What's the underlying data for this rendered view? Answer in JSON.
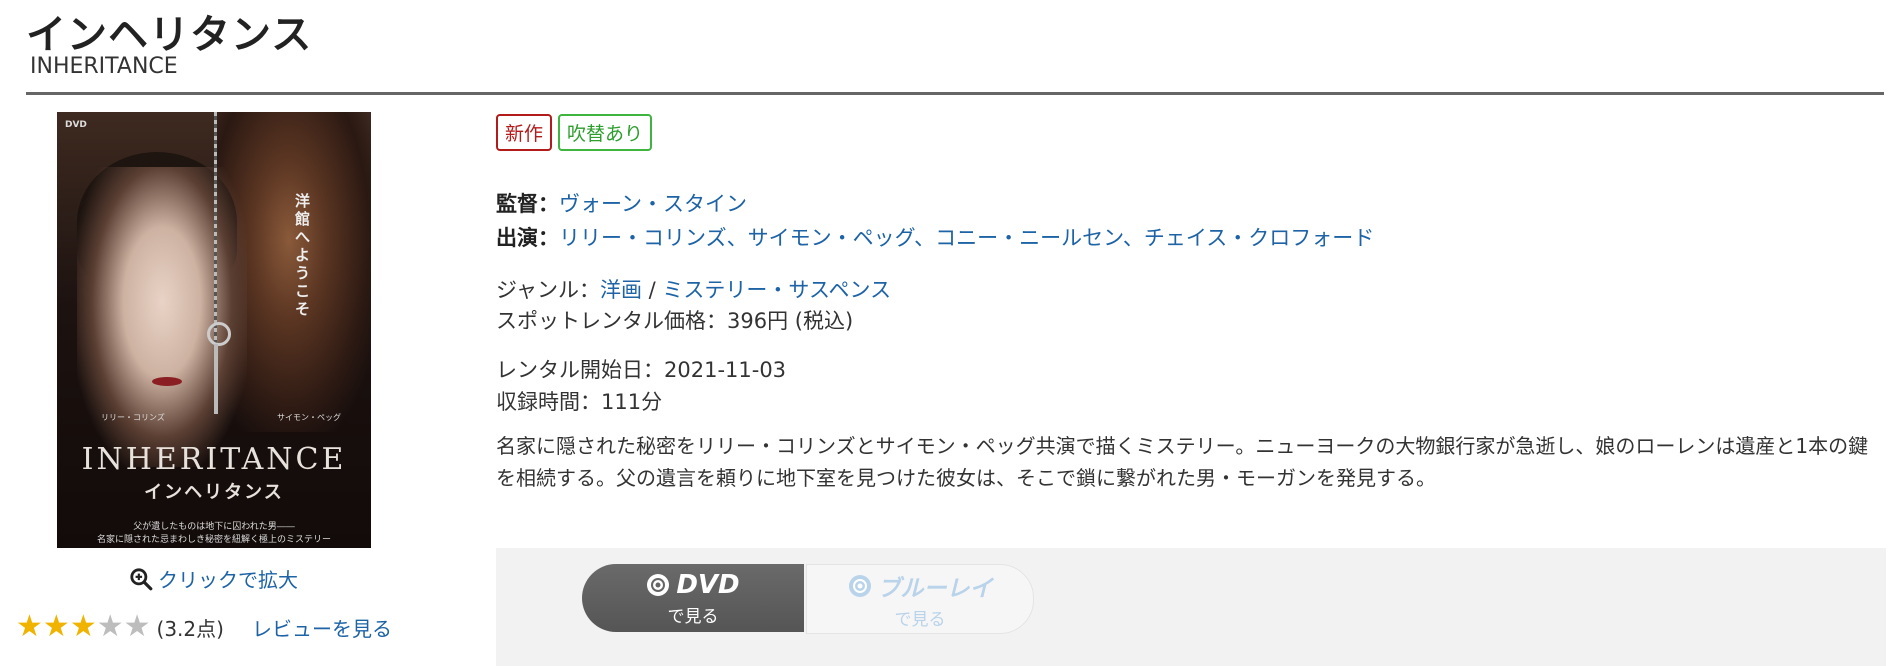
{
  "title": "インヘリタンス",
  "subtitle": "INHERITANCE",
  "poster": {
    "dvd_mark": "DVD",
    "vertical_text": "洋館へようこそ",
    "credit_left": "リリー・コリンズ",
    "credit_right": "サイモン・ペッグ",
    "title_en": "INHERITANCE",
    "title_ja": "インヘリタンス",
    "tagline1": "父が遺したものは地下に囚われた男――",
    "tagline2": "名家に隠された忌まわしき秘密を紐解く極上のミステリー"
  },
  "zoom_label": "クリックで拡大",
  "rating": {
    "stars": [
      1,
      1,
      1,
      0,
      0
    ],
    "score_text": "(3.2点)",
    "review_link": "レビューを見る"
  },
  "badges": {
    "new": "新作",
    "dub": "吹替あり"
  },
  "director": {
    "label": "監督：",
    "name": "ヴォーン・スタイン"
  },
  "cast": {
    "label": "出演：",
    "names": [
      "リリー・コリンズ",
      "サイモン・ペッグ",
      "コニー・ニールセン",
      "チェイス・クロフォード"
    ],
    "separator": "、"
  },
  "genre": {
    "label": "ジャンル：",
    "main": "洋画",
    "sep": " / ",
    "sub": "ミステリー・サスペンス"
  },
  "price": {
    "label": "スポットレンタル価格：",
    "value": "396円 (税込)"
  },
  "release": {
    "label": "レンタル開始日：",
    "value": "2021-11-03"
  },
  "runtime": {
    "label": "収録時間：",
    "value": "111分"
  },
  "description": "名家に隠された秘密をリリー・コリンズとサイモン・ペッグ共演で描くミステリー。ニューヨークの大物銀行家が急逝し、娘のローレンは遺産と1本の鍵を相続する。父の遺言を頼りに地下室を見つけた彼女は、そこで鎖に繋がれた男・モーガンを発見する。",
  "format_buttons": {
    "dvd": {
      "label": "DVD",
      "sub": "で見る"
    },
    "bluray": {
      "label": "ブルーレイ",
      "sub": "で見る"
    }
  },
  "colors": {
    "link": "#1d63a6",
    "new_badge": "#b31b1b",
    "dub_badge": "#3fb43f",
    "star_on": "#f0b400",
    "star_off": "#bdbdbd"
  }
}
